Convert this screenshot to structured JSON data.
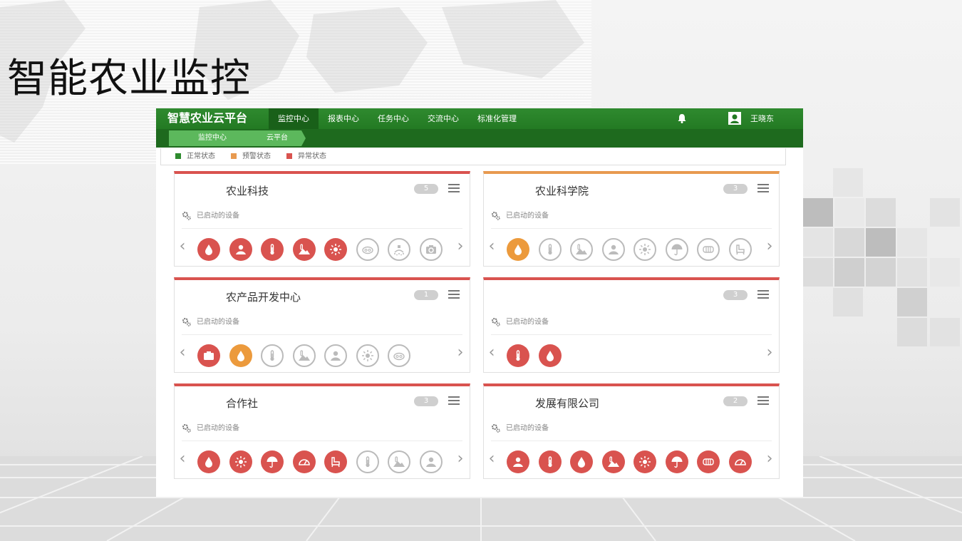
{
  "slide_title": "智能农业监控",
  "app": {
    "brand": "智慧农业云平台",
    "nav": [
      {
        "label": "监控中心",
        "active": true
      },
      {
        "label": "报表中心",
        "active": false
      },
      {
        "label": "任务中心",
        "active": false
      },
      {
        "label": "交流中心",
        "active": false
      },
      {
        "label": "标准化管理",
        "active": false
      }
    ],
    "user_name": "王晓东",
    "breadcrumb": [
      "监控中心",
      "云平台"
    ],
    "legend": [
      {
        "label": "正常状态",
        "color": "#2e8b2e"
      },
      {
        "label": "预警状态",
        "color": "#e89a50"
      },
      {
        "label": "异常状态",
        "color": "#d9534f"
      }
    ],
    "devices_label": "已启动的设备",
    "colors": {
      "accent": "#2e8b2e",
      "alarm": "#d9534f",
      "warning": "#ec9a3c",
      "inactive": "#bbbbbb"
    }
  },
  "cards": [
    {
      "title": "农业科技",
      "count": "5",
      "status": "alarm",
      "devices": [
        [
          "drop-icon",
          "red"
        ],
        [
          "soil-icon",
          "red"
        ],
        [
          "thermometer-icon",
          "red"
        ],
        [
          "hill-temp-icon",
          "red"
        ],
        [
          "sun-icon",
          "red"
        ],
        [
          "co2-icon",
          "gray"
        ],
        [
          "sprinkler-icon",
          "gray"
        ],
        [
          "camera-icon",
          "gray"
        ]
      ]
    },
    {
      "title": "农业科学院",
      "count": "3",
      "status": "warn",
      "devices": [
        [
          "drop-icon",
          "orange"
        ],
        [
          "thermometer-icon",
          "gray"
        ],
        [
          "hill-temp-icon",
          "gray"
        ],
        [
          "soil-icon",
          "gray"
        ],
        [
          "sun-icon",
          "gray"
        ],
        [
          "umbrella-icon",
          "gray"
        ],
        [
          "wind-icon",
          "gray"
        ],
        [
          "chair-icon",
          "gray"
        ]
      ]
    },
    {
      "title": "农产品开发中心",
      "count": "1",
      "status": "alarm",
      "devices": [
        [
          "camera-icon",
          "red"
        ],
        [
          "drop-icon",
          "orange"
        ],
        [
          "thermometer-icon",
          "gray"
        ],
        [
          "hill-temp-icon",
          "gray"
        ],
        [
          "soil-icon",
          "gray"
        ],
        [
          "sun-icon",
          "gray"
        ],
        [
          "co2-icon",
          "gray"
        ]
      ]
    },
    {
      "title": "",
      "count": "3",
      "status": "alarm",
      "devices": [
        [
          "thermometer-icon",
          "red"
        ],
        [
          "drop-icon",
          "red"
        ]
      ]
    },
    {
      "title": "合作社",
      "count": "3",
      "status": "alarm",
      "devices": [
        [
          "drop-icon",
          "red"
        ],
        [
          "sun-icon",
          "red"
        ],
        [
          "umbrella-icon",
          "red"
        ],
        [
          "gauge-icon",
          "red"
        ],
        [
          "chair-icon",
          "red"
        ],
        [
          "thermometer-icon",
          "gray"
        ],
        [
          "hill-temp-icon",
          "gray"
        ],
        [
          "soil-icon",
          "gray"
        ]
      ]
    },
    {
      "title": "发展有限公司",
      "count": "2",
      "status": "alarm",
      "devices": [
        [
          "soil-icon",
          "red"
        ],
        [
          "thermometer-icon",
          "red"
        ],
        [
          "drop-icon",
          "red"
        ],
        [
          "hill-temp-icon",
          "red"
        ],
        [
          "sun-icon",
          "red"
        ],
        [
          "umbrella-icon",
          "red"
        ],
        [
          "wind-icon",
          "red"
        ],
        [
          "gauge-icon",
          "red"
        ]
      ]
    }
  ]
}
